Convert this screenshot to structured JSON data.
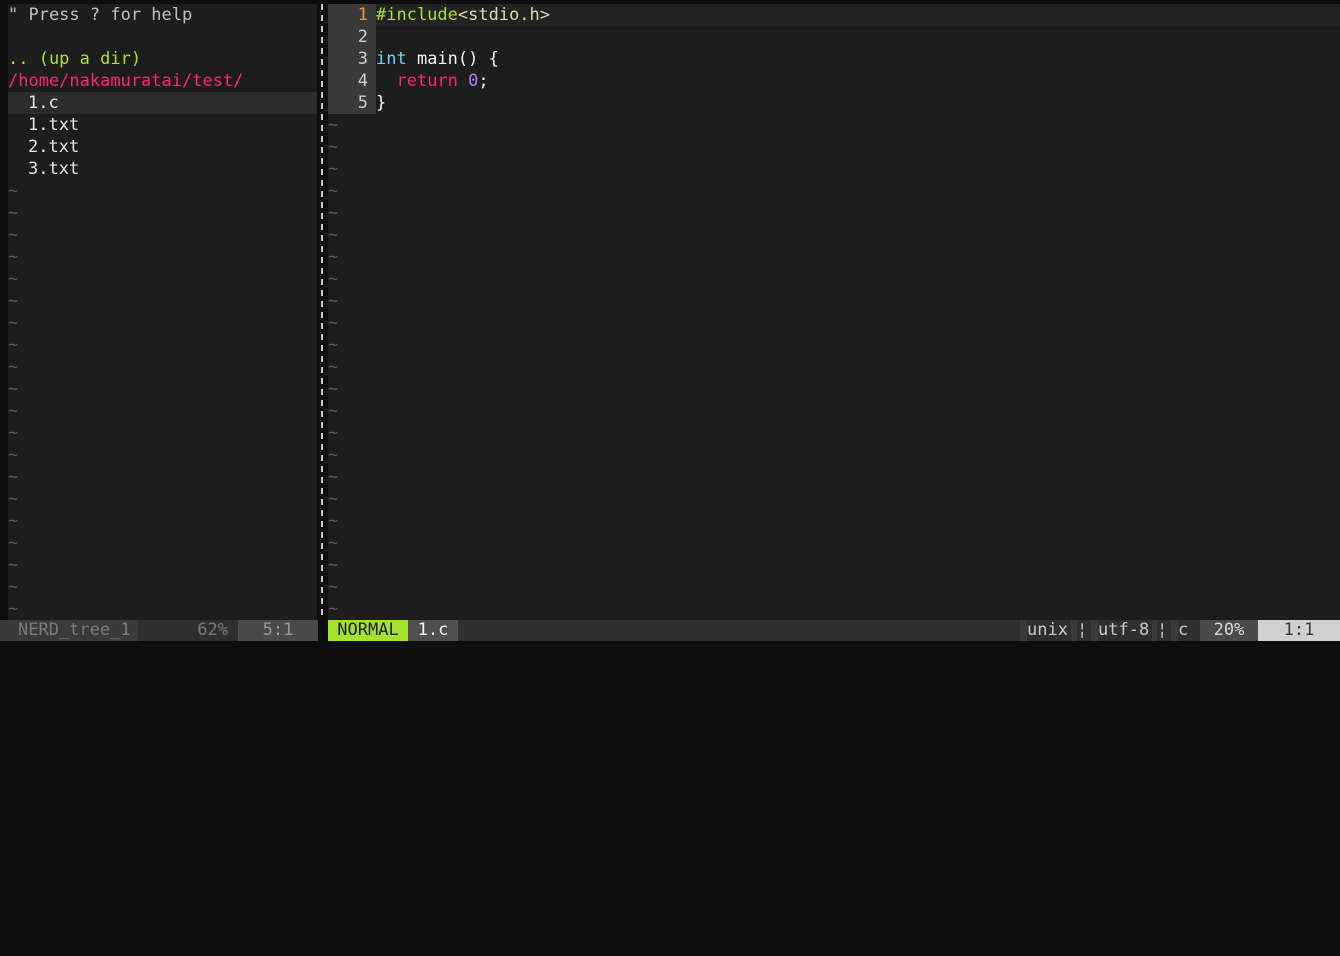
{
  "tree": {
    "help_line": "\" Press ? for help",
    "up_dir": ".. (up a dir)",
    "root_path": "/home/nakamuratai/test/",
    "files": [
      "1.c",
      "1.txt",
      "2.txt",
      "3.txt"
    ],
    "empty_marker": "~"
  },
  "editor": {
    "line_numbers": [
      "1",
      "2",
      "3",
      "4",
      "5"
    ],
    "code": {
      "line1_directive": "#include",
      "line1_header": "<stdio.h>",
      "line3_type": "int",
      "line3_rest": " main() {",
      "line4_indent": "  ",
      "line4_keyword": "return",
      "line4_space": " ",
      "line4_number": "0",
      "line4_semicolon": ";",
      "line5": "}"
    },
    "empty_marker": "~"
  },
  "statusbar": {
    "left_name": "NERD_tree_1",
    "left_percent": "62%",
    "left_position": "5:1",
    "mode": "NORMAL",
    "filename": "1.c",
    "fileformat": "unix",
    "sep1": "¦",
    "encoding": "utf-8",
    "sep2": "¦",
    "filetype": "c",
    "percent": "20%",
    "position": "1:1"
  },
  "colors": {
    "mode_bg": "#a6e22e",
    "tree_root": "#f92672",
    "tree_updir": "#a6e22e",
    "current_line_number": "#fd971f"
  }
}
